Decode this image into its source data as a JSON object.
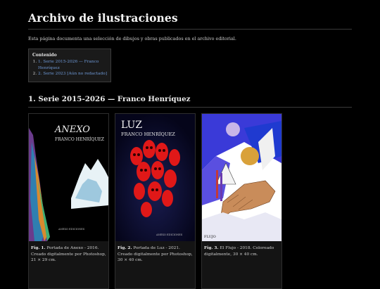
{
  "page": {
    "title": "Archivo de ilustraciones",
    "intro": "Esta página documenta una selección de dibujos y obras publicados en el archivo editorial."
  },
  "toc": {
    "title": "Contenido",
    "items": [
      {
        "num": "1.",
        "label_line1": "1. Serie 2015-2026 — Franco",
        "label_line2": "Henríquez"
      },
      {
        "num": "2.",
        "label_line1": "2. Serie 2023 [Aún no redactado]"
      }
    ]
  },
  "section": {
    "title": "1. Serie 2015-2026 — Franco Henríquez"
  },
  "figures": [
    {
      "cover_title": "ANEXO",
      "cover_author": "FRANCO HENRÍQUEZ",
      "cover_publisher": "ANEXO EDICIONES",
      "fig": "Fig. 1.",
      "caption": "Portada de Anexo - 2016. Creado digitalmente por Photoshop, 21 × 29 cm."
    },
    {
      "cover_title": "LUZ",
      "cover_author": "FRANCO HENRÍQUEZ",
      "cover_publisher": "ANEXO EDICIONES",
      "fig": "Fig. 2.",
      "caption": "Portada de Luz - 2021. Creado digitalmente por Photoshop, 30 × 40 cm."
    },
    {
      "cover_title": "FLUJO",
      "fig": "Fig. 3.",
      "caption": "El Flujo - 2018. Coloreado digitalmente, 30 × 40 cm."
    }
  ],
  "colors": {
    "background": "#000000",
    "link": "#6f9ad8",
    "card": "#141414"
  }
}
